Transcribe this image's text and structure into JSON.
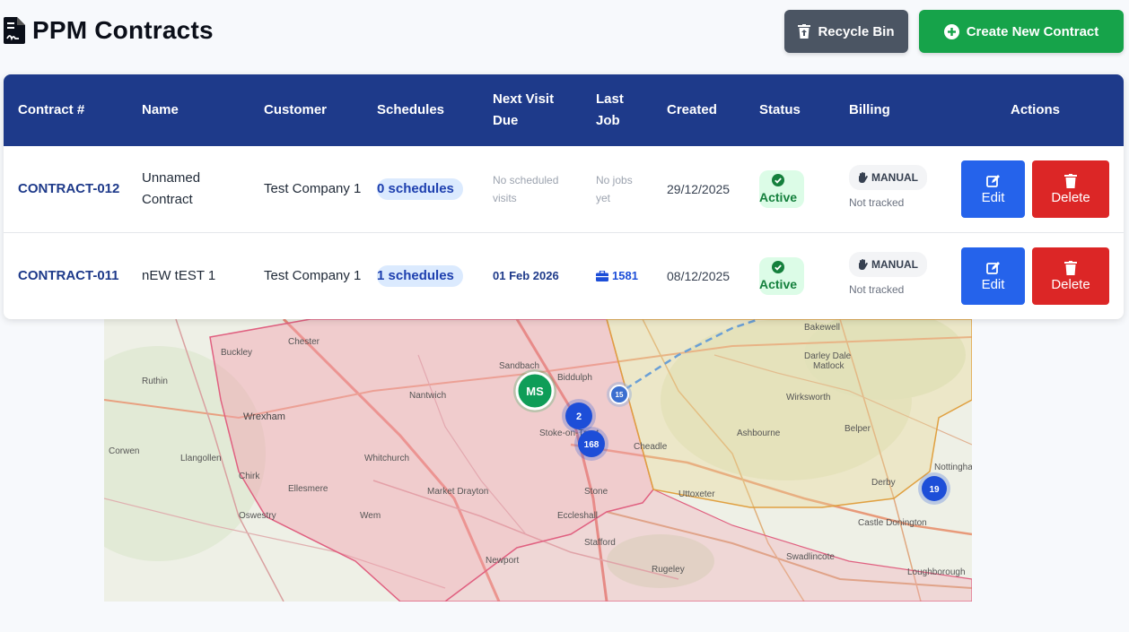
{
  "header": {
    "title": "PPM Contracts",
    "recycle_label": "Recycle Bin",
    "create_label": "Create New Contract"
  },
  "table": {
    "columns": [
      "Contract #",
      "Name",
      "Customer",
      "Schedules",
      "Next Visit Due",
      "Last Job",
      "Created",
      "Status",
      "Billing",
      "Actions"
    ],
    "rows": [
      {
        "contract": "CONTRACT-012",
        "name": "Unnamed Contract",
        "customer": "Test Company 1",
        "schedules": "0 schedules",
        "next_visit": "No scheduled visits",
        "last_job": "No jobs yet",
        "created": "29/12/2025",
        "status": "Active",
        "billing": "MANUAL",
        "billing_sub": "Not tracked",
        "edit": "Edit",
        "delete": "Delete"
      },
      {
        "contract": "CONTRACT-011",
        "name": "nEW tEST 1",
        "customer": "Test Company 1",
        "schedules": "1 schedules",
        "next_visit": "01 Feb 2026",
        "last_job": "1581",
        "created": "08/12/2025",
        "status": "Active",
        "billing": "MANUAL",
        "billing_sub": "Not tracked",
        "edit": "Edit",
        "delete": "Delete"
      }
    ]
  },
  "map": {
    "places": [
      "Chester",
      "Buckley",
      "Ruthin",
      "Wrexham",
      "Llangollen",
      "Corwen",
      "Chirk",
      "Oswestry",
      "Ellesmere",
      "Whitchurch",
      "Nantwich",
      "Sandbach",
      "Biddulph",
      "Stoke-on-Trent",
      "Market Drayton",
      "Stone",
      "Eccleshall",
      "Stafford",
      "Newport",
      "Rugeley",
      "Wem",
      "Uttoxeter",
      "Ashbourne",
      "Cheadle",
      "Derby",
      "Bakewell",
      "Matlock",
      "Darley Dale",
      "Wirksworth",
      "Belper",
      "Castle Donington",
      "Loughborough",
      "Swadlincote",
      "Nottingham"
    ],
    "markers": [
      {
        "label": "MS",
        "kind": "green"
      },
      {
        "label": "2",
        "kind": "blue"
      },
      {
        "label": "168",
        "kind": "blue"
      },
      {
        "label": "19",
        "kind": "blue"
      },
      {
        "label": "15",
        "kind": "blue"
      }
    ]
  },
  "colors": {
    "header_bg": "#1e3a8a",
    "create": "#16a34a",
    "recycle": "#4b5563",
    "edit": "#2563eb",
    "delete": "#dc2626",
    "active": "#15803d"
  },
  "icons": {
    "title": "file-contract-icon",
    "recycle": "trash-restore-icon",
    "create": "plus-circle-icon",
    "status": "check-circle-icon",
    "billing": "hand-icon",
    "last_job": "briefcase-icon",
    "edit": "edit-icon",
    "delete": "trash-icon"
  }
}
